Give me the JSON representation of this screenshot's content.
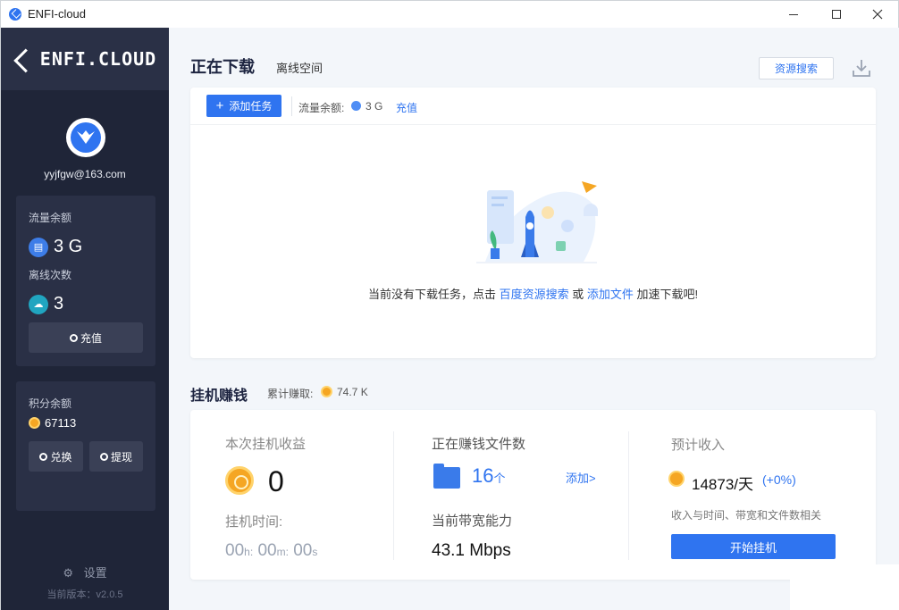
{
  "window": {
    "title": "ENFI-cloud",
    "minimize_icon": "minimize-icon",
    "maximize_icon": "maximize-icon",
    "close_icon": "close-icon"
  },
  "sidebar": {
    "logo_text": "ENFI.CLOUD",
    "user_email": "yyjfgw@163.com",
    "traffic_label": "流量余额",
    "traffic_value": "3 G",
    "offline_label": "离线次数",
    "offline_value": "3",
    "recharge_label": "充值",
    "points_label": "积分余额",
    "points_value": "67113",
    "exchange_label": "兑换",
    "withdraw_label": "提现",
    "settings_label": "设置",
    "version_label": "当前版本：v2.0.5"
  },
  "downloads": {
    "title": "正在下载",
    "offline_space": "离线空间",
    "resource_search": "资源搜索",
    "add_task": "添加任务",
    "traffic_label": "流量余额:",
    "traffic_value": "3 G",
    "recharge": "充值",
    "empty_prefix": "当前没有下载任务，点击 ",
    "empty_link1": "百度资源搜索",
    "empty_or": " 或 ",
    "empty_link2": "添加文件",
    "empty_suffix": " 加速下载吧!"
  },
  "earn": {
    "title": "挂机赚钱",
    "total_label": "累计赚取:",
    "total_value": "74.7 K",
    "session_label": "本次挂机收益",
    "session_value": "0",
    "time_label": "挂机时间:",
    "time_h": "00",
    "time_h_unit": "h:",
    "time_m": "00",
    "time_m_unit": "m:",
    "time_s": "00",
    "time_s_unit": "s",
    "files_label": "正在赚钱文件数",
    "files_count": "16",
    "files_unit": "个",
    "add_link": "添加>",
    "bandwidth_label": "当前带宽能力",
    "bandwidth_value": "43.1 Mbps",
    "income_label": "预计收入",
    "income_value": "14873/天",
    "income_pct": "(+0%)",
    "income_note": "收入与时间、带宽和文件数相关",
    "start_button": "开始挂机"
  },
  "colors": {
    "accent": "#2f74f0",
    "sidebar_bg": "#1f2538",
    "coin": "#f5a623"
  }
}
